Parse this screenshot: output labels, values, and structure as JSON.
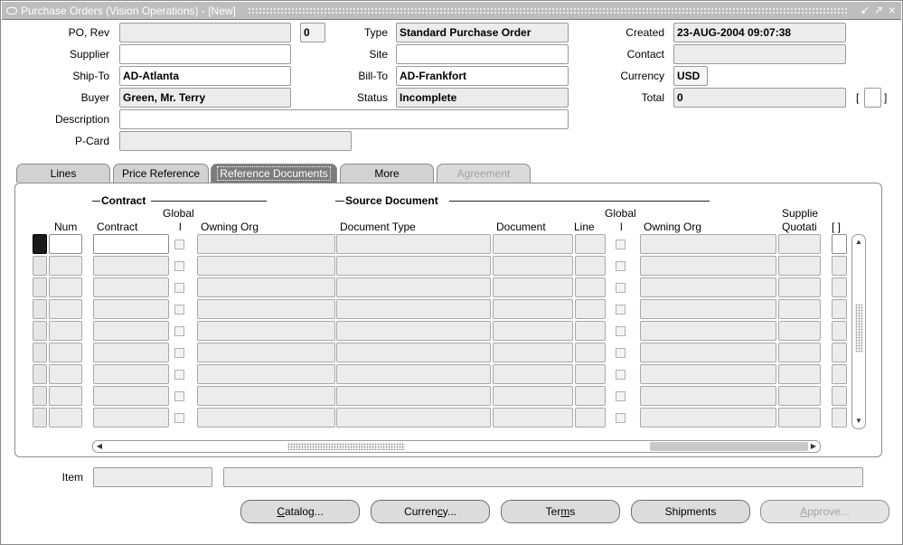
{
  "window": {
    "title": "Purchase Orders (Vision Operations) - [New]",
    "controls": {
      "restore": "↙",
      "maximize": "↗",
      "close": "×"
    }
  },
  "header": {
    "po_rev_label": "PO, Rev",
    "po_number": "",
    "revision": "0",
    "type_label": "Type",
    "type_value": "Standard Purchase Order",
    "created_label": "Created",
    "created_value": "23-AUG-2004 09:07:38",
    "supplier_label": "Supplier",
    "supplier_value": "",
    "site_label": "Site",
    "site_value": "",
    "contact_label": "Contact",
    "contact_value": "",
    "ship_to_label": "Ship-To",
    "ship_to_value": "AD-Atlanta",
    "bill_to_label": "Bill-To",
    "bill_to_value": "AD-Frankfort",
    "currency_label": "Currency",
    "currency_value": "USD",
    "buyer_label": "Buyer",
    "buyer_value": "Green, Mr. Terry",
    "status_label": "Status",
    "status_value": "Incomplete",
    "total_label": "Total",
    "total_value": "0",
    "bracket_open": "[",
    "bracket_close": "]",
    "description_label": "Description",
    "description_value": "",
    "pcard_label": "P-Card",
    "pcard_value": ""
  },
  "tabs": [
    {
      "label": "Lines",
      "state": "normal"
    },
    {
      "label": "Price Reference",
      "state": "normal"
    },
    {
      "label": "Reference Documents",
      "state": "active"
    },
    {
      "label": "More",
      "state": "normal"
    },
    {
      "label": "Agreement",
      "state": "disabled"
    }
  ],
  "grid": {
    "group_contract": "Contract",
    "group_source": "Source Document",
    "col_num": "Num",
    "col_contract": "Contract",
    "col_global1_top": "Global",
    "col_global1_bottom": "l",
    "col_owning_org1": "Owning Org",
    "col_doc_type": "Document Type",
    "col_document": "Document",
    "col_line": "Line",
    "col_global2_top": "Global",
    "col_global2_bottom": "l",
    "col_owning_org2": "Owning Org",
    "col_supplier_top": "Supplie",
    "col_supplier_bottom": "Quotati",
    "col_flex": "[ ]",
    "row_count": 9
  },
  "footer": {
    "item_label": "Item",
    "item_value": "",
    "item_description": ""
  },
  "buttons": {
    "catalog": "Catalog...",
    "currency": "Currency...",
    "terms": "Terms",
    "shipments": "Shipments",
    "approve": "Approve..."
  },
  "colors": {
    "title_bar": "#bdbdbd",
    "active_tab": "#7c7c7c",
    "read_only_field": "#ececec",
    "disabled_text": "#a3a3a3"
  }
}
